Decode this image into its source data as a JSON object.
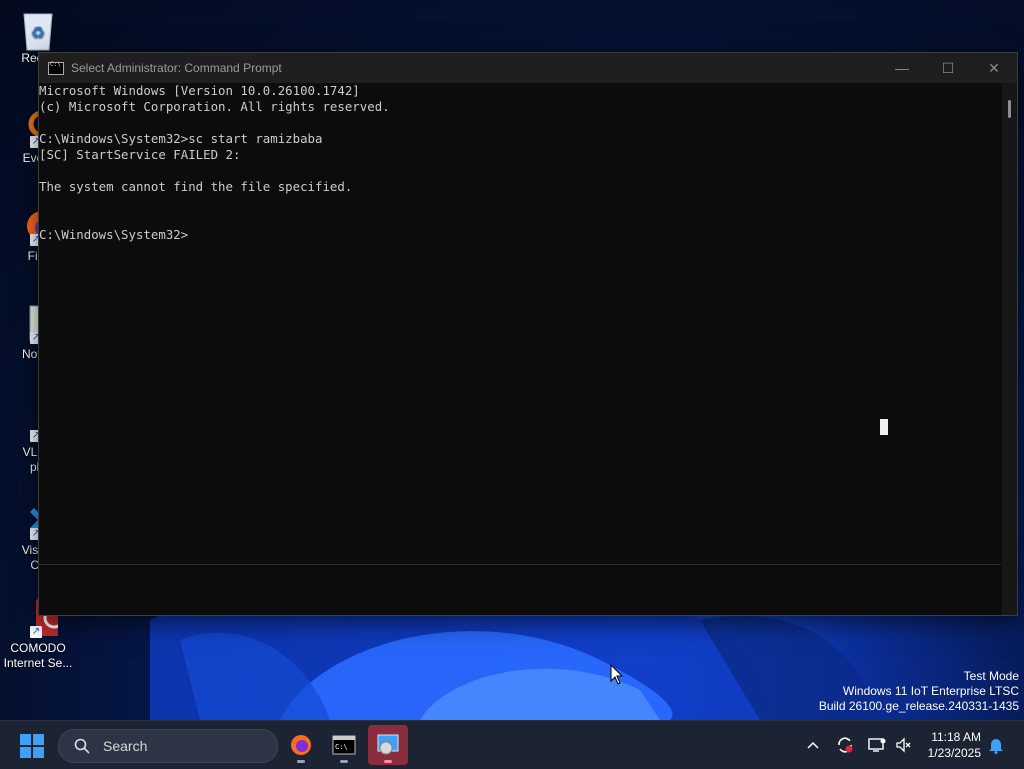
{
  "desktop": {
    "icons": [
      {
        "name": "recycle-bin",
        "label": "Recyc",
        "label2": ""
      },
      {
        "name": "everything",
        "label": "Every",
        "label2": ""
      },
      {
        "name": "firefox",
        "label": "Fire",
        "label2": ""
      },
      {
        "name": "notepad",
        "label": "Notep",
        "label2": ""
      },
      {
        "name": "vlc",
        "label": "VLC r",
        "label2": "pla"
      },
      {
        "name": "visual-studio-code",
        "label": "Visual",
        "label2": "Co"
      },
      {
        "name": "comodo",
        "label": "COMODO",
        "label2": "Internet Se..."
      }
    ],
    "watermark": [
      "Test Mode",
      "Windows 11 IoT Enterprise LTSC",
      "Build 26100.ge_release.240331-1435"
    ]
  },
  "window": {
    "title": "Select Administrator: Command Prompt",
    "minimize_glyph": "—",
    "maximize_glyph": "☐",
    "close_glyph": "✕",
    "console_lines": [
      "Microsoft Windows [Version 10.0.26100.1742]",
      "(c) Microsoft Corporation. All rights reserved.",
      "",
      "C:\\Windows\\System32>sc start ramizbaba",
      "[SC] StartService FAILED 2:",
      "",
      "The system cannot find the file specified.",
      "",
      "",
      "C:\\Windows\\System32>"
    ]
  },
  "taskbar": {
    "search_label": "Search",
    "apps": [
      {
        "name": "firefox",
        "active": false
      },
      {
        "name": "command-prompt",
        "active": false
      },
      {
        "name": "control-panel",
        "active": true
      }
    ],
    "clock": {
      "time": "11:18 AM",
      "date": "1/23/2025"
    }
  },
  "colors": {
    "console_bg": "#0c0c0c",
    "console_text": "#cccccc",
    "taskbar_bg": "#1c2433",
    "accent_blue": "#3fa0f5",
    "active_app_bg": "#8a2e3e"
  }
}
